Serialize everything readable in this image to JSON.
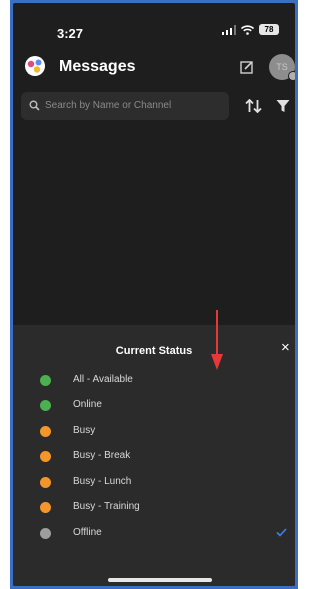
{
  "status_bar": {
    "time": "3:27",
    "battery": "78"
  },
  "header": {
    "title": "Messages",
    "avatar_initials": "TS"
  },
  "search": {
    "placeholder": "Search by Name or Channel"
  },
  "status_sheet": {
    "title": "Current Status",
    "close_symbol": "×",
    "options": [
      {
        "label": "All - Available",
        "color": "#4caf50",
        "selected": false
      },
      {
        "label": "Online",
        "color": "#4caf50",
        "selected": false
      },
      {
        "label": "Busy",
        "color": "#f5962b",
        "selected": false
      },
      {
        "label": "Busy - Break",
        "color": "#f5962b",
        "selected": false
      },
      {
        "label": "Busy - Lunch",
        "color": "#f5962b",
        "selected": false
      },
      {
        "label": "Busy - Training",
        "color": "#f5962b",
        "selected": false
      },
      {
        "label": "Offline",
        "color": "#9e9e9e",
        "selected": true
      }
    ]
  },
  "colors": {
    "background": "#1e1e1e",
    "sheet": "#2b2b2b",
    "accent": "#3b82f6",
    "annotation_arrow": "#e53935",
    "frame_border": "#3b6fc4"
  },
  "icons": {
    "logo": "chat-bubble-logo-icon",
    "compose": "compose-icon",
    "search": "search-icon",
    "sort": "sort-icon",
    "filter": "filter-icon",
    "check": "checkmark-icon"
  }
}
